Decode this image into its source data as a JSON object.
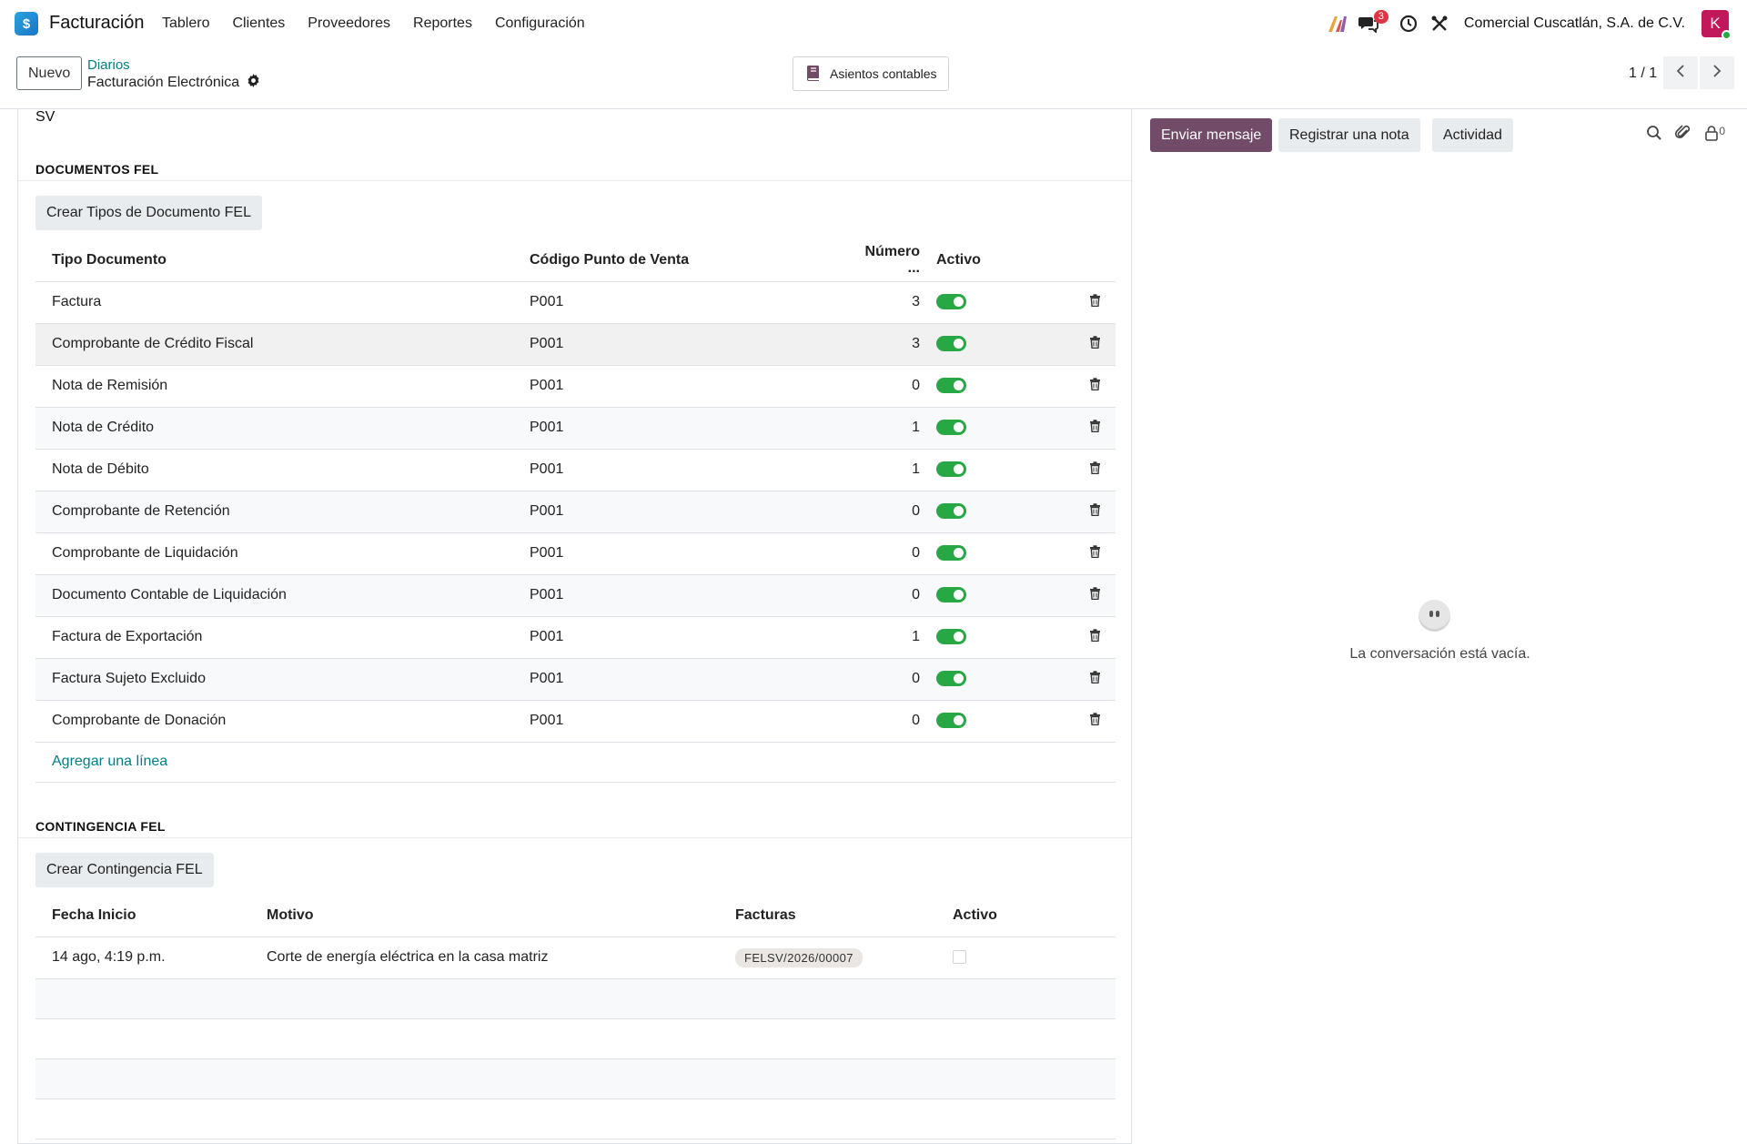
{
  "navbar": {
    "app_name": "Facturación",
    "menu": [
      "Tablero",
      "Clientes",
      "Proveedores",
      "Reportes",
      "Configuración"
    ],
    "messages_badge": "3",
    "company": "Comercial Cuscatlán, S.A. de C.V.",
    "avatar_letter": "K"
  },
  "control": {
    "new_button": "Nuevo",
    "breadcrumb": "Diarios",
    "record_title": "Facturación Electrónica",
    "smart_button": "Asientos contables",
    "pager": "1 / 1"
  },
  "form": {
    "country_code": "SV",
    "documentos": {
      "title": "DOCUMENTOS FEL",
      "create_button": "Crear Tipos de Documento FEL",
      "columns": [
        "Tipo Documento",
        "Código Punto de Venta",
        "Número ...",
        "Activo"
      ],
      "rows": [
        {
          "tipo": "Factura",
          "codigo": "P001",
          "numero": "3",
          "activo": true
        },
        {
          "tipo": "Comprobante de Crédito Fiscal",
          "codigo": "P001",
          "numero": "3",
          "activo": true
        },
        {
          "tipo": "Nota de Remisión",
          "codigo": "P001",
          "numero": "0",
          "activo": true
        },
        {
          "tipo": "Nota de Crédito",
          "codigo": "P001",
          "numero": "1",
          "activo": true
        },
        {
          "tipo": "Nota de Débito",
          "codigo": "P001",
          "numero": "1",
          "activo": true
        },
        {
          "tipo": "Comprobante de Retención",
          "codigo": "P001",
          "numero": "0",
          "activo": true
        },
        {
          "tipo": "Comprobante de Liquidación",
          "codigo": "P001",
          "numero": "0",
          "activo": true
        },
        {
          "tipo": "Documento Contable de Liquidación",
          "codigo": "P001",
          "numero": "0",
          "activo": true
        },
        {
          "tipo": "Factura de Exportación",
          "codigo": "P001",
          "numero": "1",
          "activo": true
        },
        {
          "tipo": "Factura Sujeto Excluido",
          "codigo": "P001",
          "numero": "0",
          "activo": true
        },
        {
          "tipo": "Comprobante de Donación",
          "codigo": "P001",
          "numero": "0",
          "activo": true
        }
      ],
      "add_line": "Agregar una línea"
    },
    "contingencia": {
      "title": "CONTINGENCIA FEL",
      "create_button": "Crear Contingencia FEL",
      "columns": [
        "Fecha Inicio",
        "Motivo",
        "Facturas",
        "Activo"
      ],
      "rows": [
        {
          "fecha": "14 ago, 4:19 p.m.",
          "motivo": "Corte de energía eléctrica en la casa matriz",
          "factura": "FELSV/2026/00007",
          "activo": false
        }
      ]
    }
  },
  "chatter": {
    "send_message": "Enviar mensaje",
    "log_note": "Registrar una nota",
    "activity": "Actividad",
    "followers_count": "0",
    "empty_text": "La conversación está vacía."
  },
  "colors": {
    "primary": "#714b67",
    "link": "#017e84",
    "toggle_on": "#28a745"
  }
}
